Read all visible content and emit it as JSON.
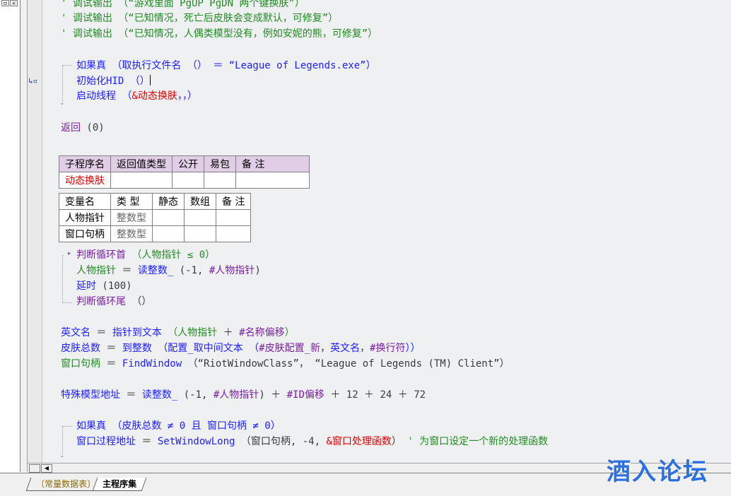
{
  "left_panel": {
    "btn1": "ㅁ",
    "btn2": "×"
  },
  "code": {
    "l1": "' 调试输出 （“游戏里面 PgUP PgDN 两个键换肤”）",
    "l2": "' 调试输出 （“已知情况，死亡后皮肤会变成默认，可修复”）",
    "l3": "' 调试输出 （“已知情况，人偶类模型没有，例如安妮的熊，可修复”）",
    "if1_kw": "如果真",
    "if1_rest": " （取执行文件名 （） ＝ “League of Legends.exe”）",
    "init_hid": "初始化HID （）",
    "thread_kw": "启动线程",
    "thread_args_open": " （",
    "thread_arg": "&动态换肤",
    "thread_args_close": "，，）",
    "ret": "返回",
    "ret_val": " (0)",
    "loop_head_kw": "判断循环首",
    "loop_head_rest": " （人物指针 ≤ 0）",
    "assign1_lhs": "人物指针",
    "assign1_op": " ＝ ",
    "assign1_fn": "读整数_",
    "assign1_args": " (-1, ",
    "assign1_const": "#人物指针",
    "assign1_close": ")",
    "delay_kw": "延时",
    "delay_val": " (100)",
    "loop_tail_kw": "判断循环尾",
    "loop_tail_rest": " （）",
    "en_lhs": "英文名",
    "en_op": " ＝ ",
    "en_fn": "指针到文本",
    "en_open": " （",
    "en_arg1": "人物指针",
    "en_plus": " ＋ ",
    "en_const": "#名称偏移",
    "en_close": "）",
    "skin_lhs": "皮肤总数",
    "skin_op": " ＝ ",
    "skin_fn": "到整数",
    "skin_open": " （",
    "skin_fn2": "配置_取中间文本",
    "skin_open2": " （",
    "skin_c1": "#皮肤配置_新",
    "skin_sep1": "，",
    "skin_a2": "英文名",
    "skin_sep2": "，",
    "skin_c2": "#换行符",
    "skin_close": "））",
    "win_lhs": "窗口句柄",
    "win_op": " ＝ ",
    "win_fn": "FindWindow",
    "win_args": " （“RiotWindowClass”， “League of Legends (TM) Client”）",
    "sp_lhs": "特殊模型地址",
    "sp_op": " ＝ ",
    "sp_fn": "读整数_",
    "sp_open": " (-1, ",
    "sp_c1": "#人物指针",
    "sp_mid": ") ＋ ",
    "sp_c2": "#ID偏移",
    "sp_tail": " ＋ 12 ＋ 24 ＋ 72",
    "if2_kw": "如果真",
    "if2_rest": " （皮肤总数 ≠ 0 且 窗口句柄 ≠ 0）",
    "proc_lhs": "窗口过程地址",
    "proc_op": " ＝ ",
    "proc_fn": "SetWindowLong",
    "proc_open": " （窗口句柄, -4, ",
    "proc_const": "&窗口处理函数",
    "proc_close": "）",
    "proc_comment": " ' 为窗口设定一个新的处理函数"
  },
  "sub_table": {
    "headers": [
      "子程序名",
      "返回值类型",
      "公开",
      "易包",
      "备 注"
    ],
    "row": [
      "动态换肤",
      "",
      "",
      "",
      ""
    ]
  },
  "var_table": {
    "headers": [
      "变量名",
      "类 型",
      "静态",
      "数组",
      "备 注"
    ],
    "rows": [
      [
        "人物指针",
        "整数型",
        "",
        "",
        ""
      ],
      [
        "窗口句柄",
        "整数型",
        "",
        "",
        ""
      ]
    ]
  },
  "tabs": {
    "tab1": "〔常量数据表〕",
    "tab2": "主程序集"
  },
  "watermark": "酒入论坛",
  "scroll": {
    "left_arrow": "◀"
  },
  "colors": {
    "keyword": "#2020ff",
    "comment": "#228b22",
    "constant": "#7a1fa2",
    "function_ref": "#e00000",
    "header_bg": "#e2cde6"
  },
  "icons": {
    "gutter_marker": "step-marker-icon"
  }
}
